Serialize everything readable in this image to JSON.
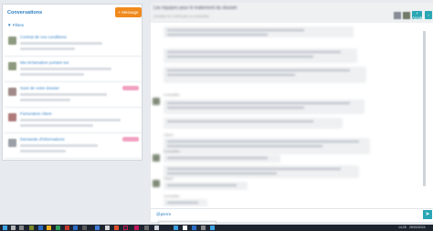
{
  "left": {
    "title": "Conversations",
    "new_button": "+ Message",
    "filter": "▼ Filtres",
    "items": [
      {
        "name": "Contrat de vos conditions",
        "tag": false
      },
      {
        "name": "Ma réclamation portant sur",
        "tag": false
      },
      {
        "name": "Suivi de votre dossier",
        "tag": true
      },
      {
        "name": "Facturation client",
        "tag": false
      },
      {
        "name": "Demande d'informations",
        "tag": true
      }
    ]
  },
  "thread": {
    "title": "Les équipes pour le traitement du dossier",
    "subtitle": "Création le 12/03 par un conseiller",
    "add_button": "+ Ajouter",
    "nav_button": "›",
    "senders": [
      "Conseiller",
      "Client",
      "Conseiller",
      "Client",
      "Conseiller"
    ]
  },
  "composer": {
    "mention": "@pierre",
    "send_icon": "send-icon"
  },
  "taskbar": {
    "clock": "14:25",
    "date": "25/03/2024"
  }
}
